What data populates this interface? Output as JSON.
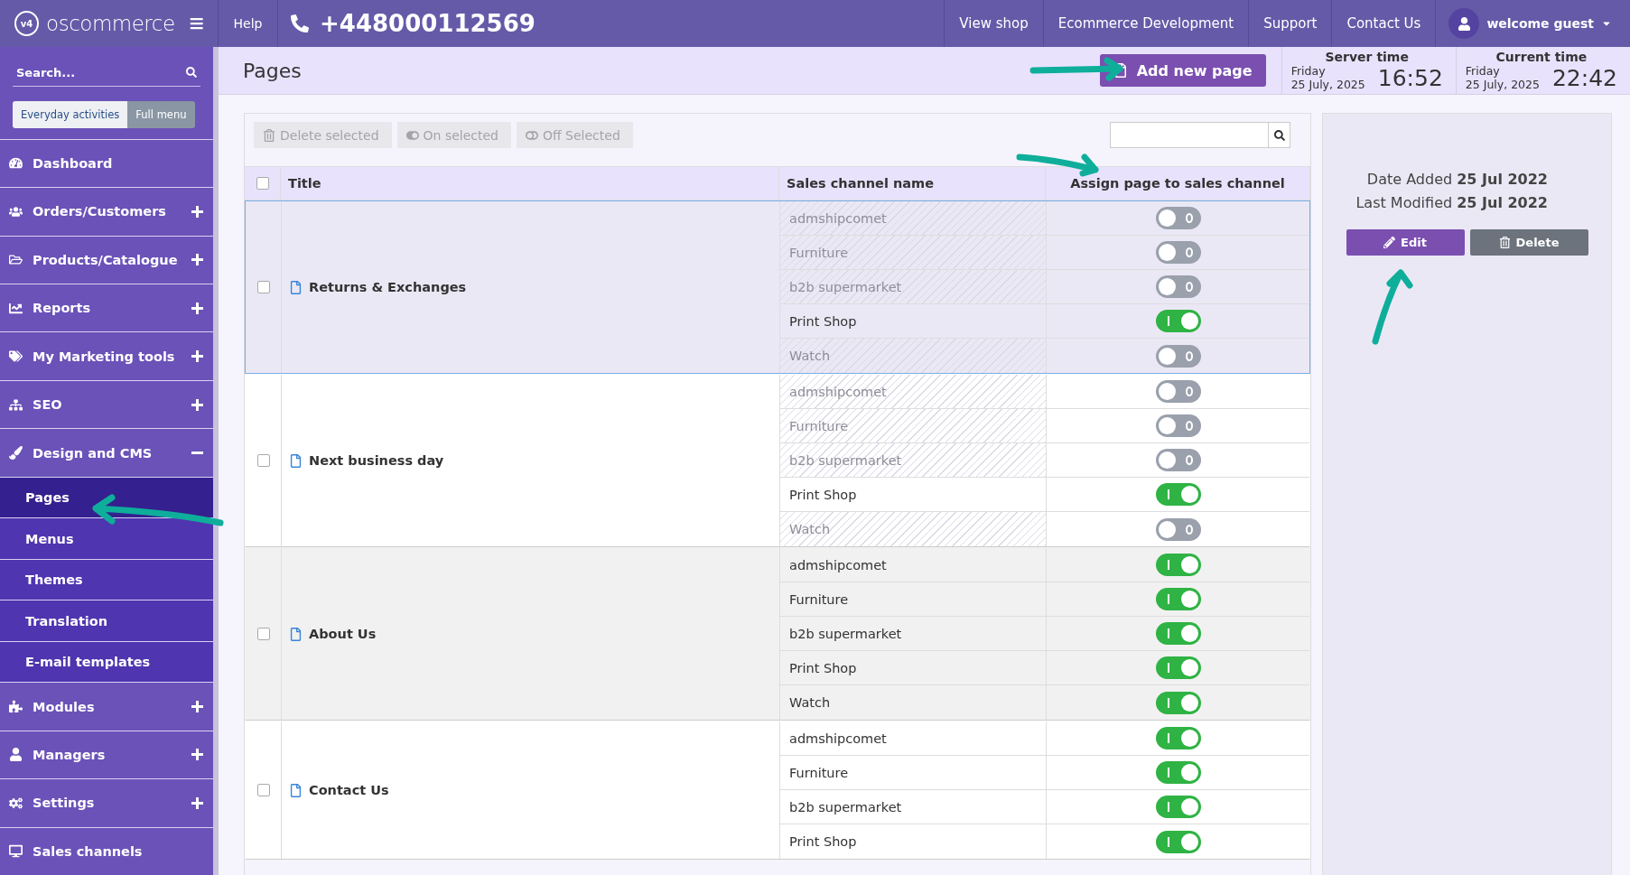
{
  "header": {
    "logo_badge": "v4",
    "logo_text": "oscommerce",
    "help": "Help",
    "phone": "+448000112569",
    "nav": [
      "View shop",
      "Ecommerce Development",
      "Support",
      "Contact Us"
    ],
    "user": "welcome guest"
  },
  "sidebar": {
    "search_placeholder": "Search...",
    "modes": [
      {
        "label": "Everyday activities",
        "selected": true
      },
      {
        "label": "Full menu",
        "selected": false
      }
    ],
    "items": [
      {
        "label": "Dashboard",
        "kind": "link"
      },
      {
        "label": "Orders/Customers",
        "kind": "group",
        "expanded": false
      },
      {
        "label": "Products/Catalogue",
        "kind": "group",
        "expanded": false
      },
      {
        "label": "Reports",
        "kind": "group",
        "expanded": false
      },
      {
        "label": "My Marketing tools",
        "kind": "group",
        "expanded": false
      },
      {
        "label": "SEO",
        "kind": "group",
        "expanded": false
      },
      {
        "label": "Design and CMS",
        "kind": "group",
        "expanded": true,
        "children": [
          {
            "label": "Pages",
            "selected": true
          },
          {
            "label": "Menus",
            "selected": false
          },
          {
            "label": "Themes",
            "selected": false
          },
          {
            "label": "Translation",
            "selected": false
          },
          {
            "label": "E-mail templates",
            "selected": false
          }
        ]
      },
      {
        "label": "Modules",
        "kind": "group",
        "expanded": false
      },
      {
        "label": "Managers",
        "kind": "group",
        "expanded": false
      },
      {
        "label": "Settings",
        "kind": "group",
        "expanded": false
      },
      {
        "label": "Sales channels",
        "kind": "link"
      }
    ]
  },
  "page_header": {
    "title": "Pages",
    "add_button": "Add new page",
    "clocks": [
      {
        "label": "Server time",
        "day": "Friday",
        "date": "25 July, 2025",
        "time": "16:52"
      },
      {
        "label": "Current time",
        "day": "Friday",
        "date": "25 July, 2025",
        "time": "22:42"
      }
    ]
  },
  "toolbar": {
    "buttons": [
      {
        "label": "Delete selected",
        "kind": "delete",
        "disabled": true
      },
      {
        "label": "On selected",
        "kind": "on",
        "disabled": true
      },
      {
        "label": "Off Selected",
        "kind": "off",
        "disabled": true
      }
    ]
  },
  "table": {
    "all_checked": false,
    "columns": [
      "Title",
      "Sales channel name",
      "Assign page to sales channel"
    ],
    "rows": [
      {
        "title": "Returns & Exchanges",
        "selected": true,
        "checked": false,
        "channels": [
          {
            "name": "admshipcomet",
            "assigned": false
          },
          {
            "name": "Furniture",
            "assigned": false
          },
          {
            "name": "b2b supermarket",
            "assigned": false
          },
          {
            "name": "Print Shop",
            "assigned": true
          },
          {
            "name": "Watch",
            "assigned": false
          }
        ]
      },
      {
        "title": "Next business day",
        "selected": false,
        "checked": false,
        "channels": [
          {
            "name": "admshipcomet",
            "assigned": false
          },
          {
            "name": "Furniture",
            "assigned": false
          },
          {
            "name": "b2b supermarket",
            "assigned": false
          },
          {
            "name": "Print Shop",
            "assigned": true
          },
          {
            "name": "Watch",
            "assigned": false
          }
        ]
      },
      {
        "title": "About Us",
        "selected": false,
        "checked": false,
        "channels": [
          {
            "name": "admshipcomet",
            "assigned": true
          },
          {
            "name": "Furniture",
            "assigned": true
          },
          {
            "name": "b2b supermarket",
            "assigned": true
          },
          {
            "name": "Print Shop",
            "assigned": true
          },
          {
            "name": "Watch",
            "assigned": true
          }
        ]
      },
      {
        "title": "Contact Us",
        "selected": false,
        "checked": false,
        "channels": [
          {
            "name": "admshipcomet",
            "assigned": true
          },
          {
            "name": "Furniture",
            "assigned": true
          },
          {
            "name": "b2b supermarket",
            "assigned": true
          },
          {
            "name": "Print Shop",
            "assigned": true
          }
        ]
      }
    ]
  },
  "details": {
    "fields": [
      {
        "label": "Date Added",
        "value": "25 Jul 2022"
      },
      {
        "label": "Last Modified",
        "value": "25 Jul 2022"
      }
    ],
    "buttons": [
      {
        "label": "Edit",
        "kind": "edit"
      },
      {
        "label": "Delete",
        "kind": "delete"
      }
    ]
  }
}
